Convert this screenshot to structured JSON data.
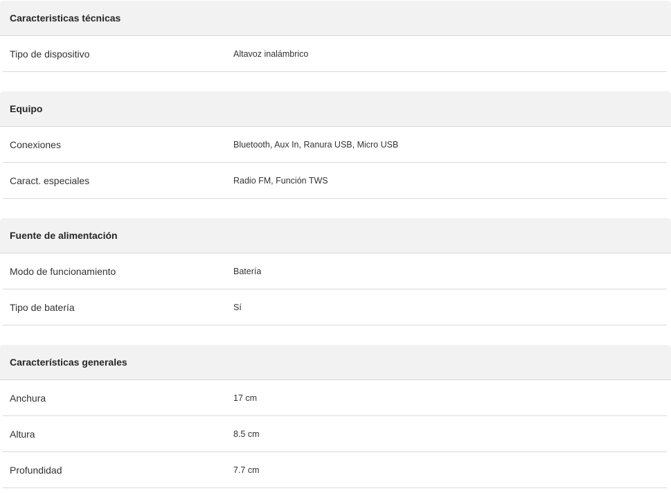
{
  "sections": [
    {
      "title": "Caracteristicas técnicas",
      "rows": [
        {
          "label": "Tipo de dispositivo",
          "value": "Altavoz inalámbrico"
        }
      ]
    },
    {
      "title": "Equipo",
      "rows": [
        {
          "label": "Conexiones",
          "value": "Bluetooth, Aux In, Ranura USB, Micro USB"
        },
        {
          "label": "Caract. especiales",
          "value": "Radio FM, Función TWS"
        }
      ]
    },
    {
      "title": "Fuente de alimentación",
      "rows": [
        {
          "label": "Modo de funcionamiento",
          "value": "Batería"
        },
        {
          "label": "Tipo de batería",
          "value": "Sí"
        }
      ]
    },
    {
      "title": "Características generales",
      "rows": [
        {
          "label": "Anchura",
          "value": "17 cm"
        },
        {
          "label": "Altura",
          "value": "8.5 cm"
        },
        {
          "label": "Profundidad",
          "value": "7.7 cm"
        }
      ]
    }
  ]
}
